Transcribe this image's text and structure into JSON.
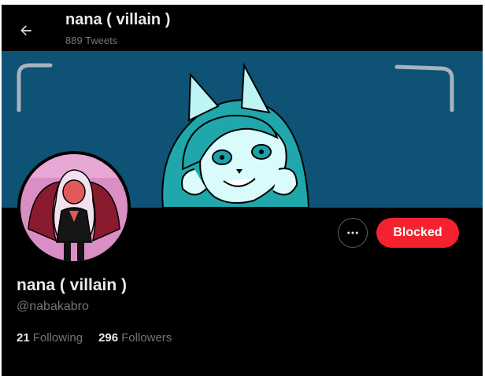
{
  "header": {
    "title": "nana ( villain )",
    "tweet_count": "889 Tweets",
    "back_icon": "arrow-left-icon"
  },
  "profile": {
    "display_name": "nana ( villain )",
    "handle": "@nabakabro",
    "following_count": "21",
    "following_label": "Following",
    "followers_count": "296",
    "followers_label": "Followers"
  },
  "actions": {
    "more_icon": "more-horizontal-icon",
    "blocked_label": "Blocked"
  },
  "colors": {
    "background": "#000000",
    "banner": "#0e5275",
    "blocked_button": "#f4212e",
    "text_primary": "#e7e9ea",
    "text_secondary": "#71767b"
  }
}
